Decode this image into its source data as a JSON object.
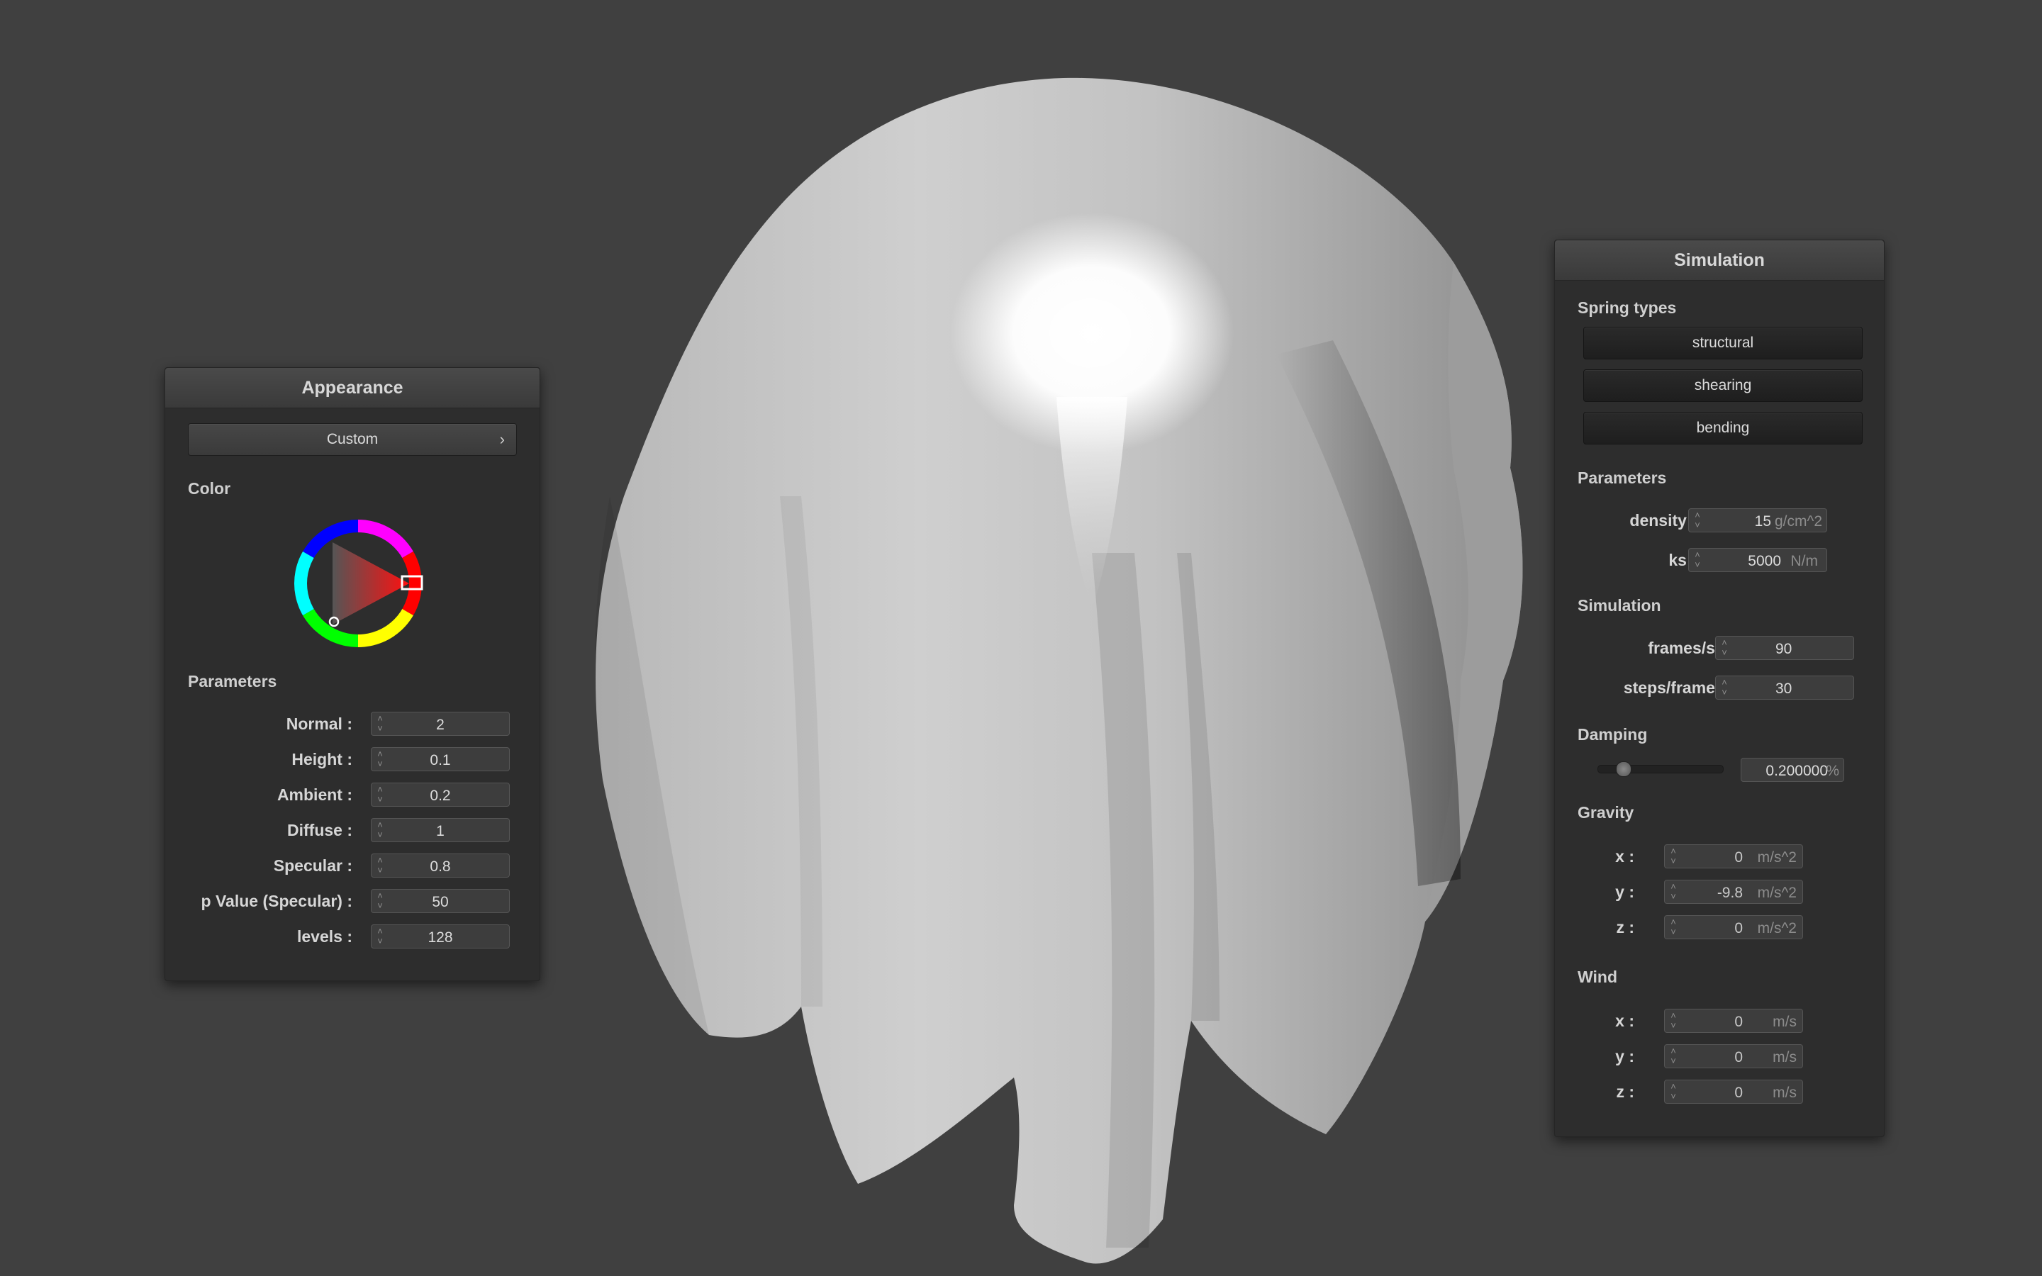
{
  "appearance": {
    "title": "Appearance",
    "preset_label": "Custom",
    "color_heading": "Color",
    "params_heading": "Parameters",
    "params": [
      {
        "label": "Normal :",
        "value": "2"
      },
      {
        "label": "Height :",
        "value": "0.1"
      },
      {
        "label": "Ambient :",
        "value": "0.2"
      },
      {
        "label": "Diffuse :",
        "value": "1"
      },
      {
        "label": "Specular :",
        "value": "0.8"
      },
      {
        "label": "p Value (Specular) :",
        "value": "50"
      },
      {
        "label": "levels :",
        "value": "128"
      }
    ],
    "selected_color": "#ff0000"
  },
  "simulation": {
    "title": "Simulation",
    "spring_heading": "Spring types",
    "springs": [
      "structural",
      "shearing",
      "bending"
    ],
    "params_heading": "Parameters",
    "density": {
      "label": "density :",
      "value": "15",
      "unit": "g/cm^2"
    },
    "ks": {
      "label": "ks :",
      "value": "5000",
      "unit": "N/m"
    },
    "sim_heading": "Simulation",
    "frames": {
      "label": "frames/s :",
      "value": "90"
    },
    "steps": {
      "label": "steps/frame :",
      "value": "30"
    },
    "damping_heading": "Damping",
    "damping": {
      "value": "0.200000",
      "unit": "%",
      "slider_fraction": 0.2
    },
    "gravity_heading": "Gravity",
    "gravity": [
      {
        "label": "x :",
        "value": "0",
        "unit": "m/s^2"
      },
      {
        "label": "y :",
        "value": "-9.8",
        "unit": "m/s^2"
      },
      {
        "label": "z :",
        "value": "0",
        "unit": "m/s^2"
      }
    ],
    "wind_heading": "Wind",
    "wind": [
      {
        "label": "x :",
        "value": "0",
        "unit": "m/s"
      },
      {
        "label": "y :",
        "value": "0",
        "unit": "m/s"
      },
      {
        "label": "z :",
        "value": "0",
        "unit": "m/s"
      }
    ]
  },
  "colors": {
    "background": "#404040",
    "panel": "#2d2d2d",
    "cloth": "#c8c8c8"
  }
}
